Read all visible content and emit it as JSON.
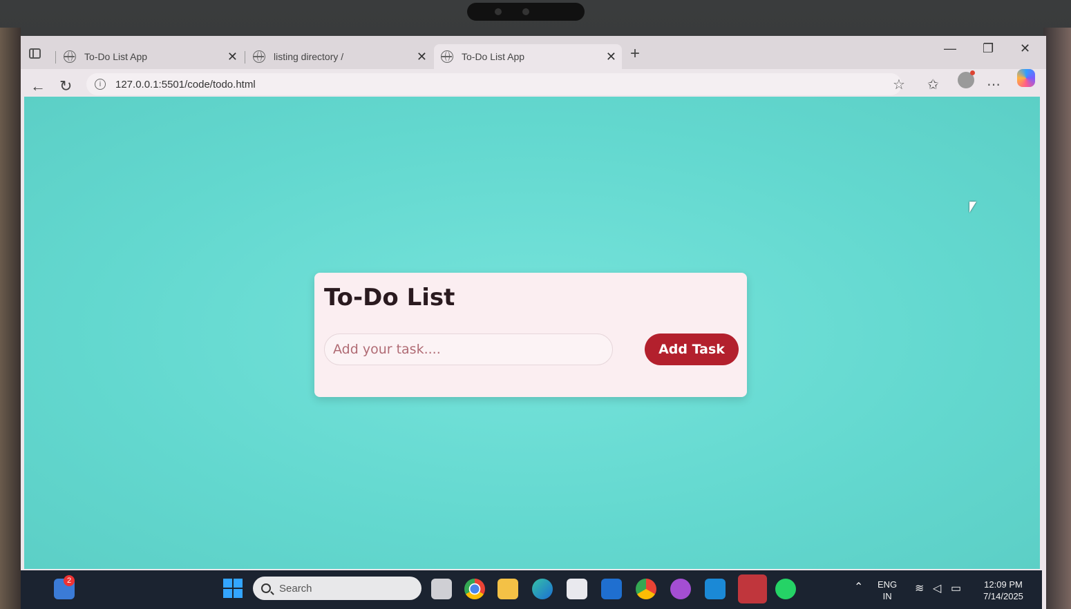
{
  "browser": {
    "tabs": [
      {
        "label": "To-Do List App",
        "active": false
      },
      {
        "label": "listing directory /",
        "active": false
      },
      {
        "label": "To-Do List App",
        "active": true
      }
    ],
    "url": "127.0.0.1:5501/code/todo.html"
  },
  "page": {
    "title": "To-Do List",
    "input_placeholder": "Add your task....",
    "add_button_label": "Add Task",
    "background_color": "#6adcd4",
    "button_color": "#b3202d"
  },
  "taskbar": {
    "search_placeholder": "Search",
    "widget_badge": "2",
    "language_line1": "ENG",
    "language_line2": "IN",
    "time": "12:09 PM",
    "date": "7/14/2025"
  }
}
